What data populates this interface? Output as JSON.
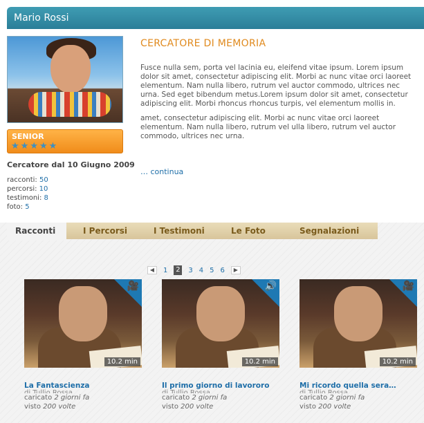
{
  "profile": {
    "name": "Mario Rossi",
    "level": "SENIOR",
    "stars": 5,
    "since": "Cercatore dal 10 Giugno 2009",
    "stats": [
      {
        "label": "racconti:",
        "value": "50"
      },
      {
        "label": "percorsi:",
        "value": "10"
      },
      {
        "label": "testimoni:",
        "value": "8"
      },
      {
        "label": "foto:",
        "value": "5"
      }
    ]
  },
  "story": {
    "title": "CERCATORE DI MEMORIA",
    "paragraph1": "Fusce nulla sem, porta vel lacinia eu, eleifend vitae ipsum. Lorem ipsum dolor sit amet, consectetur adipiscing elit. Morbi ac nunc vitae orci laoreet elementum. Nam nulla libero, rutrum vel auctor commodo, ultrices nec urna. Sed eget bibendum metus.Lorem ipsum dolor sit amet, consectetur adipiscing elit. Morbi rhoncus rhoncus turpis, vel elementum mollis in.",
    "paragraph2": "amet, consectetur adipiscing elit. Morbi ac nunc vitae orci laoreet elementum. Nam nulla libero, rutrum vel ulla libero, rutrum vel auctor commodo, ultrices nec urna.",
    "continue_label": "… continua"
  },
  "tabs": [
    "Racconti",
    "I Percorsi",
    "I Testimoni",
    "Le Foto",
    "Segnalazioni"
  ],
  "pager": {
    "prev": "◀",
    "next": "▶",
    "pages": [
      "1",
      "2",
      "3",
      "4",
      "5",
      "6"
    ],
    "current": "2"
  },
  "cards": [
    {
      "title": "La Fantascienza",
      "author": "di Tullio Rossa",
      "uploaded_prefix": "caricato",
      "uploaded": "2 giorni fa",
      "views_prefix": "visto",
      "views": "200 volte",
      "duration": "10.2 min",
      "media_icon": "video-camera-icon"
    },
    {
      "title": "Il primo giorno di lavororo",
      "author": "di Tullio Rossa",
      "uploaded_prefix": "caricato",
      "uploaded": "2 giorni fa",
      "views_prefix": "visto",
      "views": "200 volte",
      "duration": "10.2 min",
      "media_icon": "audio-speaker-icon"
    },
    {
      "title": "Mi ricordo quella sera…",
      "author": "di Tullio Rossa",
      "uploaded_prefix": "caricato",
      "uploaded": "2 giorni fa",
      "views_prefix": "visto",
      "views": "200 volte",
      "duration": "10.2 min",
      "media_icon": "video-camera-icon"
    }
  ],
  "colors": {
    "header": "#2a7e98",
    "accent": "#e08a1e",
    "link": "#1e6ea8",
    "badge": "#f08c1a"
  }
}
